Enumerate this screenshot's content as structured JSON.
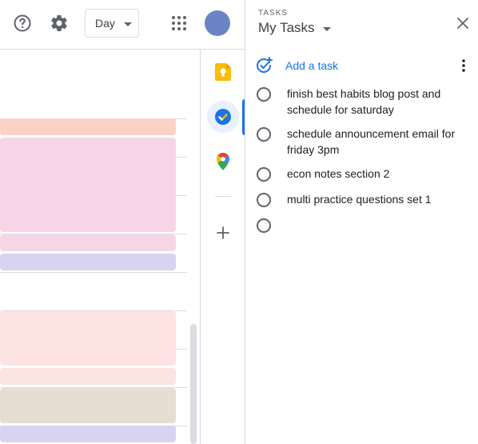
{
  "topbar": {
    "view_label": "Day",
    "icons": [
      "help-icon",
      "settings-icon",
      "apps-grid-icon"
    ]
  },
  "colors": {
    "event_peach": "#fad2c8",
    "event_pink": "#f6d6e6",
    "event_lavender": "#d8d3f0",
    "event_light_pink": "#fde3e2",
    "event_beige": "#e6ded2",
    "accent": "#1a73e8",
    "avatar": "#6b84c4"
  },
  "side_rail": {
    "items": [
      "keep-icon",
      "tasks-icon",
      "maps-icon",
      "add-icon"
    ]
  },
  "tasks_panel": {
    "label": "TASKS",
    "list_name": "My Tasks",
    "add_task_label": "Add a task",
    "tasks": [
      {
        "title": "finish best habits blog post and schedule for saturday"
      },
      {
        "title": "schedule announcement email for friday 3pm"
      },
      {
        "title": "econ notes section 2"
      },
      {
        "title": "multi practice questions set 1"
      },
      {
        "title": ""
      }
    ]
  }
}
